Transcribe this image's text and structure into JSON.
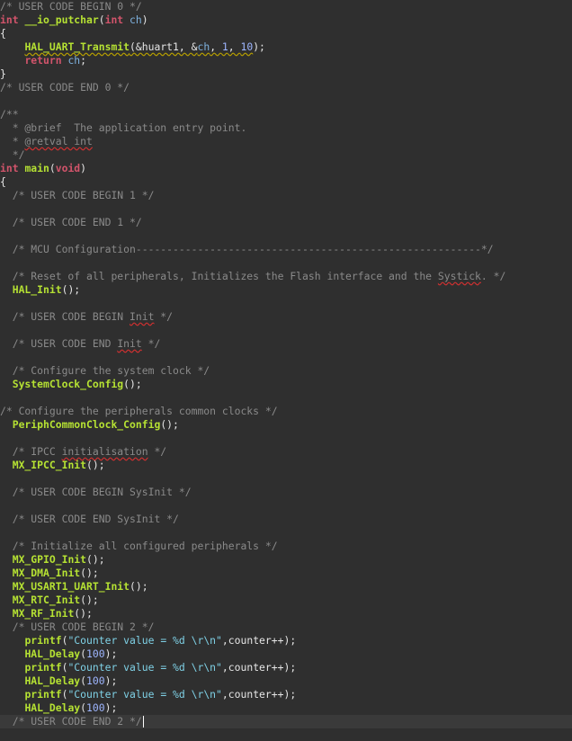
{
  "editor": {
    "current_line": 53,
    "lines": [
      [
        {
          "t": "/* USER CODE BEGIN 0 */",
          "c": "cmt"
        }
      ],
      [
        {
          "t": "int",
          "c": "kw"
        },
        {
          "t": " ",
          "c": "txt"
        },
        {
          "t": "__io_putchar",
          "c": "fn"
        },
        {
          "t": "(",
          "c": "txt"
        },
        {
          "t": "int",
          "c": "kw"
        },
        {
          "t": " ",
          "c": "txt"
        },
        {
          "t": "ch",
          "c": "var"
        },
        {
          "t": ")",
          "c": "txt"
        }
      ],
      [
        {
          "t": "{",
          "c": "txt"
        }
      ],
      [
        {
          "t": "    ",
          "c": "txt"
        },
        {
          "t": "HAL_UART_Transmit",
          "c": "fn",
          "u": "warn"
        },
        {
          "t": "(&huart1, &",
          "c": "txt",
          "u": "warn"
        },
        {
          "t": "ch",
          "c": "var",
          "u": "warn"
        },
        {
          "t": ", ",
          "c": "txt",
          "u": "warn"
        },
        {
          "t": "1",
          "c": "num",
          "u": "warn"
        },
        {
          "t": ", ",
          "c": "txt",
          "u": "warn"
        },
        {
          "t": "10",
          "c": "num",
          "u": "warn"
        },
        {
          "t": ");",
          "c": "txt"
        }
      ],
      [
        {
          "t": "    ",
          "c": "txt"
        },
        {
          "t": "return",
          "c": "kw"
        },
        {
          "t": " ",
          "c": "txt"
        },
        {
          "t": "ch",
          "c": "var"
        },
        {
          "t": ";",
          "c": "txt"
        }
      ],
      [
        {
          "t": "}",
          "c": "txt"
        }
      ],
      [
        {
          "t": "/* USER CODE END 0 */",
          "c": "cmt"
        }
      ],
      [
        {
          "t": "",
          "c": "txt"
        }
      ],
      [
        {
          "t": "/**",
          "c": "cmt"
        }
      ],
      [
        {
          "t": "  * @brief  The application entry point.",
          "c": "cmt"
        }
      ],
      [
        {
          "t": "  * ",
          "c": "cmt"
        },
        {
          "t": "@retval int",
          "c": "cmt",
          "u": "err"
        }
      ],
      [
        {
          "t": "  */",
          "c": "cmt"
        }
      ],
      [
        {
          "t": "int",
          "c": "kw"
        },
        {
          "t": " ",
          "c": "txt"
        },
        {
          "t": "main",
          "c": "fn"
        },
        {
          "t": "(",
          "c": "txt"
        },
        {
          "t": "void",
          "c": "kw"
        },
        {
          "t": ")",
          "c": "txt"
        }
      ],
      [
        {
          "t": "{",
          "c": "txt"
        }
      ],
      [
        {
          "t": "  /* USER CODE BEGIN 1 */",
          "c": "cmt"
        }
      ],
      [
        {
          "t": "",
          "c": "txt"
        }
      ],
      [
        {
          "t": "  /* USER CODE END 1 */",
          "c": "cmt"
        }
      ],
      [
        {
          "t": "",
          "c": "txt"
        }
      ],
      [
        {
          "t": "  /* MCU Configuration--------------------------------------------------------*/",
          "c": "cmt"
        }
      ],
      [
        {
          "t": "",
          "c": "txt"
        }
      ],
      [
        {
          "t": "  /* Reset of all peripherals, Initializes the Flash interface and the ",
          "c": "cmt"
        },
        {
          "t": "Systick",
          "c": "cmt",
          "u": "err"
        },
        {
          "t": ". */",
          "c": "cmt"
        }
      ],
      [
        {
          "t": "  ",
          "c": "txt"
        },
        {
          "t": "HAL_Init",
          "c": "fn"
        },
        {
          "t": "();",
          "c": "txt"
        }
      ],
      [
        {
          "t": "",
          "c": "txt"
        }
      ],
      [
        {
          "t": "  /* USER CODE BEGIN ",
          "c": "cmt"
        },
        {
          "t": "Init",
          "c": "cmt",
          "u": "err"
        },
        {
          "t": " */",
          "c": "cmt"
        }
      ],
      [
        {
          "t": "",
          "c": "txt"
        }
      ],
      [
        {
          "t": "  /* USER CODE END ",
          "c": "cmt"
        },
        {
          "t": "Init",
          "c": "cmt",
          "u": "err"
        },
        {
          "t": " */",
          "c": "cmt"
        }
      ],
      [
        {
          "t": "",
          "c": "txt"
        }
      ],
      [
        {
          "t": "  /* Configure the system clock */",
          "c": "cmt"
        }
      ],
      [
        {
          "t": "  ",
          "c": "txt"
        },
        {
          "t": "SystemClock_Config",
          "c": "fn"
        },
        {
          "t": "();",
          "c": "txt"
        }
      ],
      [
        {
          "t": "",
          "c": "txt"
        }
      ],
      [
        {
          "t": "/* Configure the peripherals common clocks */",
          "c": "cmt"
        }
      ],
      [
        {
          "t": "  ",
          "c": "txt"
        },
        {
          "t": "PeriphCommonClock_Config",
          "c": "fn"
        },
        {
          "t": "();",
          "c": "txt"
        }
      ],
      [
        {
          "t": "",
          "c": "txt"
        }
      ],
      [
        {
          "t": "  /* IPCC ",
          "c": "cmt"
        },
        {
          "t": "initialisation",
          "c": "cmt",
          "u": "err"
        },
        {
          "t": " */",
          "c": "cmt"
        }
      ],
      [
        {
          "t": "  ",
          "c": "txt"
        },
        {
          "t": "MX_IPCC_Init",
          "c": "fn"
        },
        {
          "t": "();",
          "c": "txt"
        }
      ],
      [
        {
          "t": "",
          "c": "txt"
        }
      ],
      [
        {
          "t": "  /* USER CODE BEGIN SysInit */",
          "c": "cmt"
        }
      ],
      [
        {
          "t": "",
          "c": "txt"
        }
      ],
      [
        {
          "t": "  /* USER CODE END SysInit */",
          "c": "cmt"
        }
      ],
      [
        {
          "t": "",
          "c": "txt"
        }
      ],
      [
        {
          "t": "  /* Initialize all configured peripherals */",
          "c": "cmt"
        }
      ],
      [
        {
          "t": "  ",
          "c": "txt"
        },
        {
          "t": "MX_GPIO_Init",
          "c": "fn"
        },
        {
          "t": "();",
          "c": "txt"
        }
      ],
      [
        {
          "t": "  ",
          "c": "txt"
        },
        {
          "t": "MX_DMA_Init",
          "c": "fn"
        },
        {
          "t": "();",
          "c": "txt"
        }
      ],
      [
        {
          "t": "  ",
          "c": "txt"
        },
        {
          "t": "MX_USART1_UART_Init",
          "c": "fn"
        },
        {
          "t": "();",
          "c": "txt"
        }
      ],
      [
        {
          "t": "  ",
          "c": "txt"
        },
        {
          "t": "MX_RTC_Init",
          "c": "fn"
        },
        {
          "t": "();",
          "c": "txt"
        }
      ],
      [
        {
          "t": "  ",
          "c": "txt"
        },
        {
          "t": "MX_RF_Init",
          "c": "fn"
        },
        {
          "t": "();",
          "c": "txt"
        }
      ],
      [
        {
          "t": "  /* USER CODE BEGIN 2 */",
          "c": "cmt"
        }
      ],
      [
        {
          "t": "    ",
          "c": "txt"
        },
        {
          "t": "printf",
          "c": "fn"
        },
        {
          "t": "(",
          "c": "txt"
        },
        {
          "t": "\"Counter value = %d \\r\\n\"",
          "c": "str"
        },
        {
          "t": ",counter++);",
          "c": "txt"
        }
      ],
      [
        {
          "t": "    ",
          "c": "txt"
        },
        {
          "t": "HAL_Delay",
          "c": "fn"
        },
        {
          "t": "(",
          "c": "txt"
        },
        {
          "t": "100",
          "c": "num"
        },
        {
          "t": ");",
          "c": "txt"
        }
      ],
      [
        {
          "t": "    ",
          "c": "txt"
        },
        {
          "t": "printf",
          "c": "fn"
        },
        {
          "t": "(",
          "c": "txt"
        },
        {
          "t": "\"Counter value = %d \\r\\n\"",
          "c": "str"
        },
        {
          "t": ",counter++);",
          "c": "txt"
        }
      ],
      [
        {
          "t": "    ",
          "c": "txt"
        },
        {
          "t": "HAL_Delay",
          "c": "fn"
        },
        {
          "t": "(",
          "c": "txt"
        },
        {
          "t": "100",
          "c": "num"
        },
        {
          "t": ");",
          "c": "txt"
        }
      ],
      [
        {
          "t": "    ",
          "c": "txt"
        },
        {
          "t": "printf",
          "c": "fn"
        },
        {
          "t": "(",
          "c": "txt"
        },
        {
          "t": "\"Counter value = %d \\r\\n\"",
          "c": "str"
        },
        {
          "t": ",counter++);",
          "c": "txt"
        }
      ],
      [
        {
          "t": "    ",
          "c": "txt"
        },
        {
          "t": "HAL_Delay",
          "c": "fn"
        },
        {
          "t": "(",
          "c": "txt"
        },
        {
          "t": "100",
          "c": "num"
        },
        {
          "t": ");",
          "c": "txt"
        }
      ],
      [
        {
          "t": "  /* USER CODE END 2 */",
          "c": "cmt"
        }
      ]
    ]
  }
}
